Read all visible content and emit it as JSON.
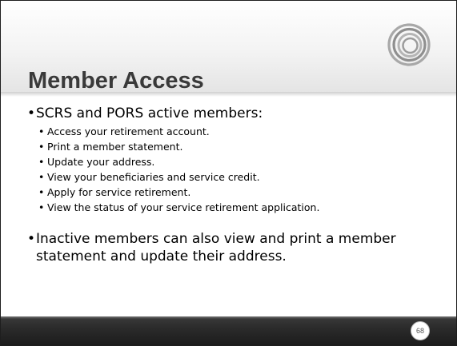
{
  "slide": {
    "title": "Member Access",
    "bullets": [
      {
        "text": "SCRS and PORS active members:",
        "sub": [
          "Access your retirement account.",
          "Print a member statement.",
          "Update your address.",
          "View your beneficiaries and service credit.",
          "Apply for service retirement.",
          "View the status of your service retirement application."
        ]
      },
      {
        "text": "Inactive members can also view and print a member statement and update their address."
      }
    ],
    "page_number": "68",
    "logo_icon": "concentric-rings-icon",
    "colors": {
      "title_text": "#3a3a3a",
      "footer_bar": "#2b2b2b",
      "logo_ring": "#9a9a9a"
    }
  }
}
